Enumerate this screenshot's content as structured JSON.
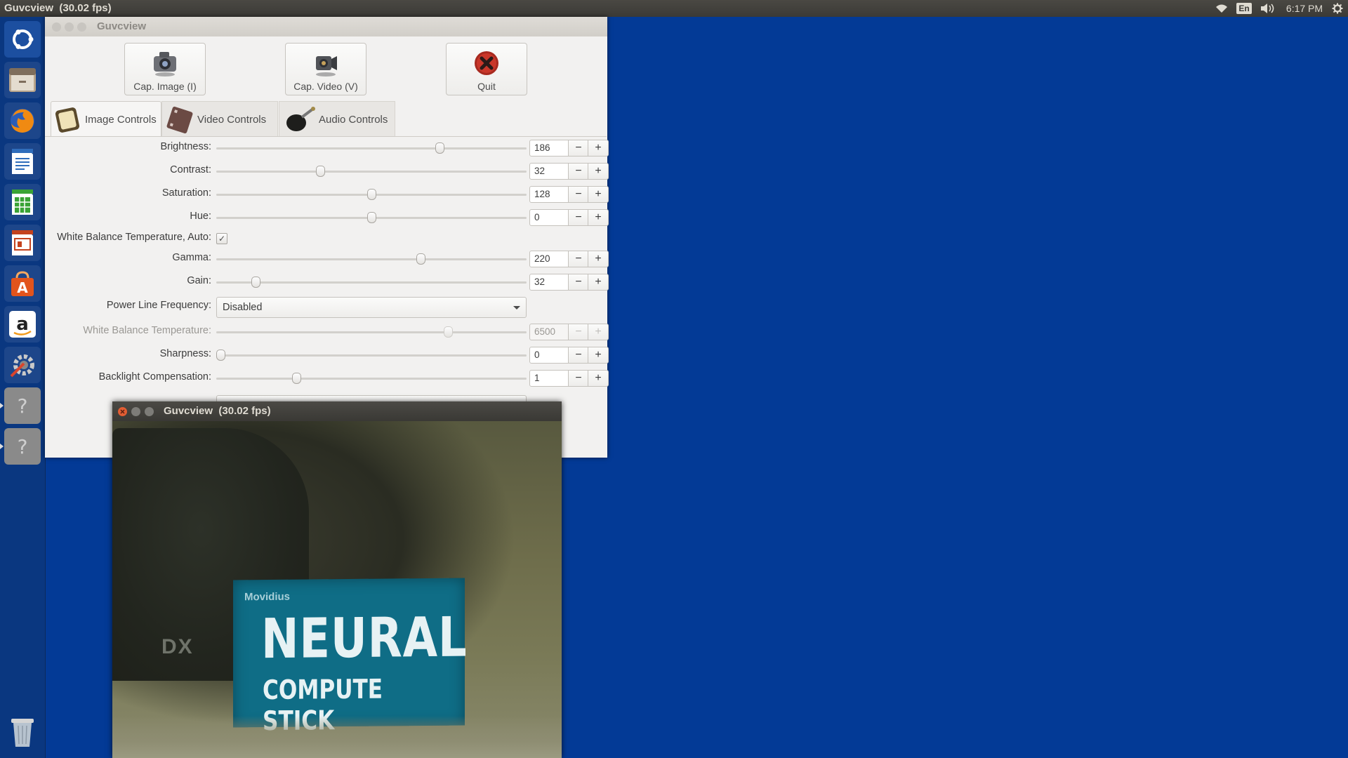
{
  "topbar": {
    "title": "Guvcview",
    "fps": "(30.02 fps)",
    "lang": "En",
    "time": "6:17 PM"
  },
  "launcher": {
    "items": [
      {
        "name": "ubuntu-dash-icon"
      },
      {
        "name": "files-icon"
      },
      {
        "name": "firefox-icon"
      },
      {
        "name": "writer-icon"
      },
      {
        "name": "calc-icon"
      },
      {
        "name": "impress-icon"
      },
      {
        "name": "software-center-icon"
      },
      {
        "name": "amazon-icon"
      },
      {
        "name": "system-settings-icon"
      },
      {
        "name": "unknown-app-icon"
      },
      {
        "name": "unknown-app-icon"
      },
      {
        "name": "trash-icon"
      }
    ]
  },
  "control_window": {
    "title": "Guvcview",
    "buttons": {
      "cap_image": "Cap. Image (I)",
      "cap_video": "Cap. Video (V)",
      "quit": "Quit"
    },
    "tabs": [
      "Image Controls",
      "Video Controls",
      "Audio Controls"
    ],
    "controls": {
      "brightness": {
        "label": "Brightness:",
        "value": "186"
      },
      "contrast": {
        "label": "Contrast:",
        "value": "32"
      },
      "saturation": {
        "label": "Saturation:",
        "value": "128"
      },
      "hue": {
        "label": "Hue:",
        "value": "0"
      },
      "wb_auto": {
        "label": "White Balance Temperature, Auto:",
        "checked": true
      },
      "gamma": {
        "label": "Gamma:",
        "value": "220"
      },
      "gain": {
        "label": "Gain:",
        "value": "32"
      },
      "power_line": {
        "label": "Power Line Frequency:",
        "value": "Disabled"
      },
      "wb_temp": {
        "label": "White Balance Temperature:",
        "value": "6500"
      },
      "sharpness": {
        "label": "Sharpness:",
        "value": "0"
      },
      "backlight": {
        "label": "Backlight Compensation:",
        "value": "1"
      }
    }
  },
  "video_window": {
    "title": "Guvcview",
    "fps": "(30.02 fps)",
    "box_brand": "Movidius",
    "box_title": "NEURAL",
    "box_subtitle": "COMPUTE STICK",
    "camera_logo": "DX"
  }
}
